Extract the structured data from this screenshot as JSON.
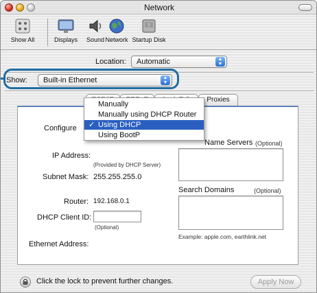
{
  "window": {
    "title": "Network"
  },
  "toolbar": {
    "items": [
      {
        "label": "Show All",
        "icon": "apple-icon"
      },
      {
        "label": "Displays",
        "icon": "display-icon"
      },
      {
        "label": "Sound",
        "icon": "speaker-icon"
      },
      {
        "label": "Network",
        "icon": "globe-icon"
      },
      {
        "label": "Startup Disk",
        "icon": "hard-disk-icon"
      }
    ]
  },
  "location": {
    "label": "Location:",
    "value": "Automatic"
  },
  "show": {
    "label": "Show:",
    "value": "Built-in Ethernet"
  },
  "tabs": [
    "TCP/IP",
    "PPPoE",
    "AppleTalk",
    "Proxies"
  ],
  "configure": {
    "label": "Configure",
    "menu": {
      "options": [
        "Manually",
        "Manually using DHCP Router",
        "Using DHCP",
        "Using BootP"
      ],
      "selected": "Using DHCP",
      "check": "✓"
    }
  },
  "fields": {
    "ip_address": {
      "label": "IP Address:",
      "hint": "(Provided by DHCP Server)"
    },
    "subnet_mask": {
      "label": "Subnet Mask:",
      "value": "255.255.255.0"
    },
    "router": {
      "label": "Router:",
      "value": "192.168.0.1"
    },
    "dhcp_client_id": {
      "label": "DHCP Client ID:",
      "value": "",
      "hint": "(Optional)"
    },
    "ethernet_address": {
      "label": "Ethernet Address:",
      "value": ""
    }
  },
  "dns": {
    "label_visible": "Name Servers",
    "optional": "(Optional)"
  },
  "search_domains": {
    "label": "Search Domains",
    "optional": "(Optional)",
    "example": "Example: apple.com, earthlink.net"
  },
  "footer": {
    "lock_text": "Click the lock to prevent further changes.",
    "apply_label": "Apply Now"
  },
  "colors": {
    "accent": "#2a5fc0",
    "highlight_ring": "#1f6da3",
    "tab_rule": "#5c7fb4"
  }
}
